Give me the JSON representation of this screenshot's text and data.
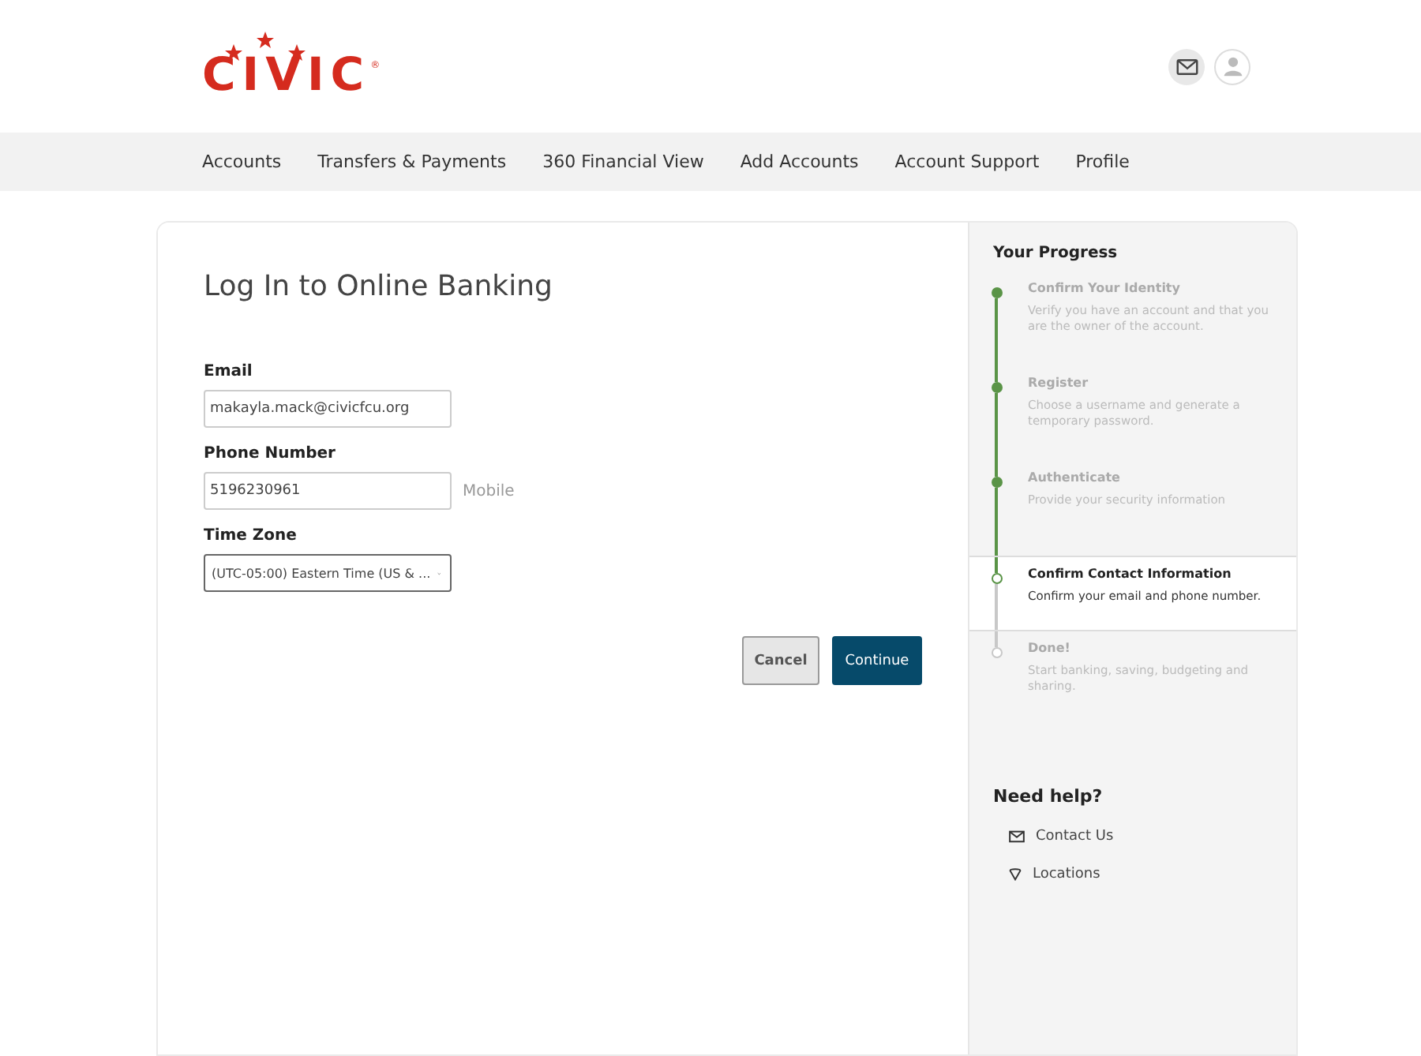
{
  "logo": {
    "text": "CIVIC",
    "mark": "®"
  },
  "nav": [
    {
      "label": "Accounts"
    },
    {
      "label": "Transfers & Payments"
    },
    {
      "label": "360 Financial View"
    },
    {
      "label": "Add Accounts"
    },
    {
      "label": "Account Support"
    },
    {
      "label": "Profile"
    }
  ],
  "form": {
    "title": "Log In to Online Banking",
    "fields": [
      {
        "kind": "text",
        "label": "Email",
        "value": "makayla.mack@civicfcu.org"
      },
      {
        "kind": "text",
        "label": "Phone Number",
        "value": "5196230961",
        "suffix": "Mobile"
      },
      {
        "kind": "select",
        "label": "Time Zone",
        "value": "(UTC-05:00) Eastern Time (US & ..."
      }
    ],
    "buttons": [
      {
        "label": "Cancel",
        "kind": "secondary"
      },
      {
        "label": "Continue",
        "kind": "primary"
      }
    ]
  },
  "progress": {
    "title": "Your Progress",
    "steps": [
      {
        "title": "Confirm Your Identity",
        "text": "Verify you have an account and that you are the owner of the account.",
        "completed": true,
        "selected": false
      },
      {
        "title": "Register",
        "text": "Choose a username and generate a temporary password.",
        "completed": true,
        "selected": false
      },
      {
        "title": "Authenticate",
        "text": "Provide your security information",
        "completed": true,
        "selected": false
      },
      {
        "title": "Confirm Contact Information",
        "text": "Confirm your email and phone number.",
        "completed": false,
        "selected": true
      },
      {
        "title": "Done!",
        "text": "Start banking, saving, budgeting and sharing.",
        "completed": false,
        "selected": false
      }
    ]
  },
  "help": {
    "title": "Need help?",
    "links": [
      {
        "kind": "mail",
        "label": "Contact Us"
      },
      {
        "kind": "pin",
        "label": "Locations"
      }
    ]
  }
}
